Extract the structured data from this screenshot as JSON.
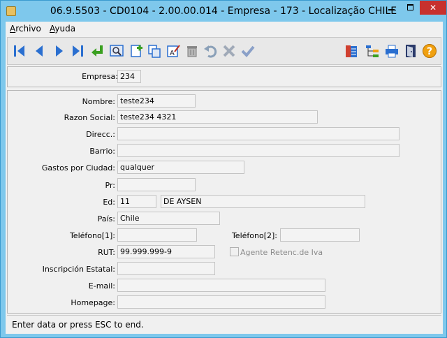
{
  "window": {
    "title": "06.9.5503 - CD0104 - 2.00.00.014 - Empresa - 173 - Localização CHILE",
    "close_glyph": "✕"
  },
  "menu": {
    "items": [
      {
        "label": "Archivo",
        "accel": "A",
        "rest": "rchivo"
      },
      {
        "label": "Ayuda",
        "accel": "A",
        "rest": "yuda"
      }
    ]
  },
  "toolbar": {
    "buttons": [
      {
        "name": "first-record-icon"
      },
      {
        "name": "previous-record-icon"
      },
      {
        "name": "next-record-icon"
      },
      {
        "name": "last-record-icon"
      },
      {
        "name": "enter-return-icon"
      },
      {
        "name": "search-icon"
      },
      {
        "name": "new-record-icon"
      },
      {
        "name": "copy-icon"
      },
      {
        "name": "edit-text-icon"
      },
      {
        "name": "delete-trash-icon"
      },
      {
        "name": "undo-icon"
      },
      {
        "name": "cancel-icon"
      },
      {
        "name": "confirm-check-icon"
      },
      {
        "name": "report-list-icon"
      },
      {
        "name": "tree-structure-icon"
      },
      {
        "name": "print-icon"
      },
      {
        "name": "exit-door-icon"
      },
      {
        "name": "help-icon"
      }
    ]
  },
  "header_form": {
    "empresa_label": "Empresa:",
    "empresa_value": "234"
  },
  "form": {
    "nombre_label": "Nombre:",
    "nombre_value": "teste234",
    "razon_label": "Razon Social:",
    "razon_value": "teste234 4321",
    "direcc_label": "Direcc.:",
    "direcc_value": "",
    "barrio_label": "Barrio:",
    "barrio_value": "",
    "gastos_label": "Gastos por Ciudad:",
    "gastos_value": "qualquer",
    "pr_label": "Pr:",
    "pr_value": "",
    "ed_label": "Ed:",
    "ed_code": "11",
    "ed_name": "DE AYSEN",
    "pais_label": "País:",
    "pais_value": "Chile",
    "telefono1_label": "Teléfono[1]:",
    "telefono1_value": "",
    "telefono2_label": "Teléfono[2]:",
    "telefono2_value": "",
    "rut_label": "RUT:",
    "rut_value": "99.999.999-9",
    "agente_label": "Agente Retenc.de Iva",
    "agente_checked": false,
    "inscripcion_label": "Inscripción Estatal:",
    "inscripcion_value": "",
    "email_label": "E-mail:",
    "email_value": "",
    "homepage_label": "Homepage:",
    "homepage_value": ""
  },
  "status": {
    "text": "Enter data or press ESC to end."
  },
  "colors": {
    "titlebar": "#7ec8ec",
    "close_button": "#c7312e",
    "toolbar_blue": "#2a6fd0",
    "accent_orange": "#f0a010"
  }
}
